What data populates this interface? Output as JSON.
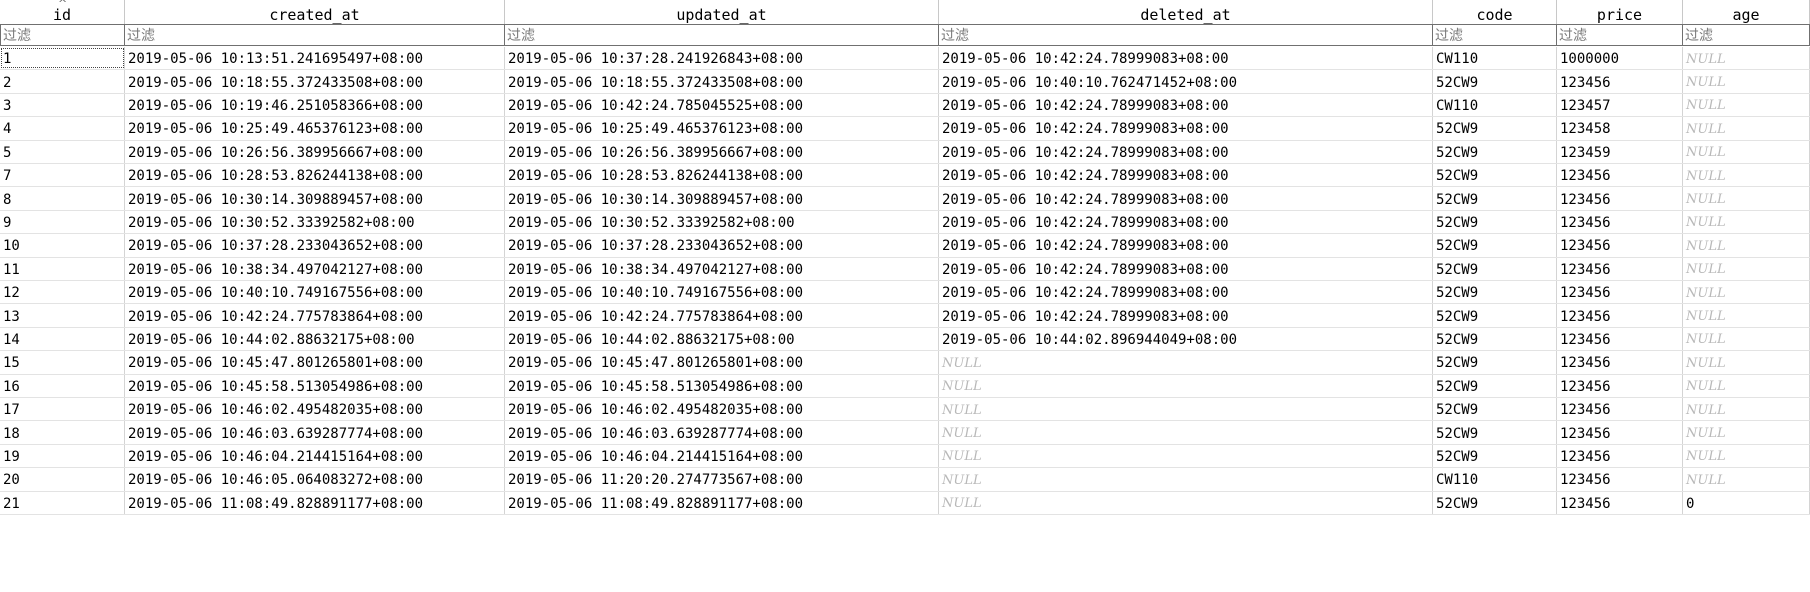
{
  "columns": [
    {
      "key": "id",
      "label": "id"
    },
    {
      "key": "created_at",
      "label": "created_at"
    },
    {
      "key": "updated_at",
      "label": "updated_at"
    },
    {
      "key": "deleted_at",
      "label": "deleted_at"
    },
    {
      "key": "code",
      "label": "code"
    },
    {
      "key": "price",
      "label": "price"
    },
    {
      "key": "age",
      "label": "age"
    }
  ],
  "sort_indicator": "^",
  "filter_placeholder": "过滤",
  "null_text": "NULL",
  "rows": [
    [
      "1",
      "2019-05-06 10:13:51.241695497+08:00",
      "2019-05-06 10:37:28.241926843+08:00",
      "2019-05-06 10:42:24.78999083+08:00",
      "CW110",
      "1000000",
      null
    ],
    [
      "2",
      "2019-05-06 10:18:55.372433508+08:00",
      "2019-05-06 10:18:55.372433508+08:00",
      "2019-05-06 10:40:10.762471452+08:00",
      "52CW9",
      "123456",
      null
    ],
    [
      "3",
      "2019-05-06 10:19:46.251058366+08:00",
      "2019-05-06 10:42:24.785045525+08:00",
      "2019-05-06 10:42:24.78999083+08:00",
      "CW110",
      "123457",
      null
    ],
    [
      "4",
      "2019-05-06 10:25:49.465376123+08:00",
      "2019-05-06 10:25:49.465376123+08:00",
      "2019-05-06 10:42:24.78999083+08:00",
      "52CW9",
      "123458",
      null
    ],
    [
      "5",
      "2019-05-06 10:26:56.389956667+08:00",
      "2019-05-06 10:26:56.389956667+08:00",
      "2019-05-06 10:42:24.78999083+08:00",
      "52CW9",
      "123459",
      null
    ],
    [
      "7",
      "2019-05-06 10:28:53.826244138+08:00",
      "2019-05-06 10:28:53.826244138+08:00",
      "2019-05-06 10:42:24.78999083+08:00",
      "52CW9",
      "123456",
      null
    ],
    [
      "8",
      "2019-05-06 10:30:14.309889457+08:00",
      "2019-05-06 10:30:14.309889457+08:00",
      "2019-05-06 10:42:24.78999083+08:00",
      "52CW9",
      "123456",
      null
    ],
    [
      "9",
      "2019-05-06 10:30:52.33392582+08:00",
      "2019-05-06 10:30:52.33392582+08:00",
      "2019-05-06 10:42:24.78999083+08:00",
      "52CW9",
      "123456",
      null
    ],
    [
      "10",
      "2019-05-06 10:37:28.233043652+08:00",
      "2019-05-06 10:37:28.233043652+08:00",
      "2019-05-06 10:42:24.78999083+08:00",
      "52CW9",
      "123456",
      null
    ],
    [
      "11",
      "2019-05-06 10:38:34.497042127+08:00",
      "2019-05-06 10:38:34.497042127+08:00",
      "2019-05-06 10:42:24.78999083+08:00",
      "52CW9",
      "123456",
      null
    ],
    [
      "12",
      "2019-05-06 10:40:10.749167556+08:00",
      "2019-05-06 10:40:10.749167556+08:00",
      "2019-05-06 10:42:24.78999083+08:00",
      "52CW9",
      "123456",
      null
    ],
    [
      "13",
      "2019-05-06 10:42:24.775783864+08:00",
      "2019-05-06 10:42:24.775783864+08:00",
      "2019-05-06 10:42:24.78999083+08:00",
      "52CW9",
      "123456",
      null
    ],
    [
      "14",
      "2019-05-06 10:44:02.88632175+08:00",
      "2019-05-06 10:44:02.88632175+08:00",
      "2019-05-06 10:44:02.896944049+08:00",
      "52CW9",
      "123456",
      null
    ],
    [
      "15",
      "2019-05-06 10:45:47.801265801+08:00",
      "2019-05-06 10:45:47.801265801+08:00",
      null,
      "52CW9",
      "123456",
      null
    ],
    [
      "16",
      "2019-05-06 10:45:58.513054986+08:00",
      "2019-05-06 10:45:58.513054986+08:00",
      null,
      "52CW9",
      "123456",
      null
    ],
    [
      "17",
      "2019-05-06 10:46:02.495482035+08:00",
      "2019-05-06 10:46:02.495482035+08:00",
      null,
      "52CW9",
      "123456",
      null
    ],
    [
      "18",
      "2019-05-06 10:46:03.639287774+08:00",
      "2019-05-06 10:46:03.639287774+08:00",
      null,
      "52CW9",
      "123456",
      null
    ],
    [
      "19",
      "2019-05-06 10:46:04.214415164+08:00",
      "2019-05-06 10:46:04.214415164+08:00",
      null,
      "52CW9",
      "123456",
      null
    ],
    [
      "20",
      "2019-05-06 10:46:05.064083272+08:00",
      "2019-05-06 11:20:20.274773567+08:00",
      null,
      "CW110",
      "123456",
      null
    ],
    [
      "21",
      "2019-05-06 11:08:49.828891177+08:00",
      "2019-05-06 11:08:49.828891177+08:00",
      null,
      "52CW9",
      "123456",
      "0"
    ]
  ]
}
